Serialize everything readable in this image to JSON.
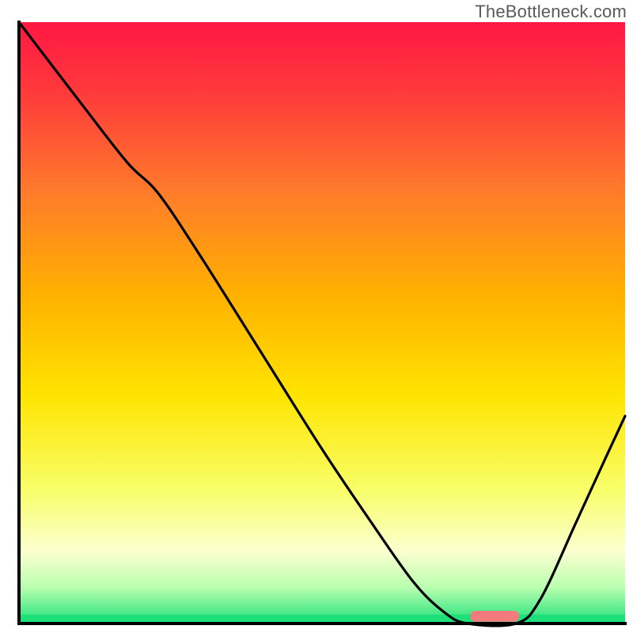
{
  "watermark": "TheBottleneck.com",
  "chart_data": {
    "type": "line",
    "title": "",
    "xlabel": "",
    "ylabel": "",
    "xlim": [
      0,
      100
    ],
    "ylim": [
      0,
      100
    ],
    "background_gradient": {
      "stops": [
        {
          "offset": 0.0,
          "color": "#ff1744"
        },
        {
          "offset": 0.12,
          "color": "#ff3b3b"
        },
        {
          "offset": 0.28,
          "color": "#ff7a2b"
        },
        {
          "offset": 0.45,
          "color": "#ffb000"
        },
        {
          "offset": 0.62,
          "color": "#ffe400"
        },
        {
          "offset": 0.78,
          "color": "#f8ff6a"
        },
        {
          "offset": 0.88,
          "color": "#fcffd0"
        },
        {
          "offset": 0.94,
          "color": "#b9ffb0"
        },
        {
          "offset": 1.0,
          "color": "#1ee07a"
        }
      ]
    },
    "curve": {
      "comment": "x as fraction of plot width (0=left,1=right), y as fraction (0=top,1=bottom). Approximated from pixels.",
      "points": [
        {
          "x": 0.0,
          "y": 0.0
        },
        {
          "x": 0.11,
          "y": 0.145
        },
        {
          "x": 0.18,
          "y": 0.235
        },
        {
          "x": 0.23,
          "y": 0.285
        },
        {
          "x": 0.3,
          "y": 0.39
        },
        {
          "x": 0.4,
          "y": 0.55
        },
        {
          "x": 0.5,
          "y": 0.71
        },
        {
          "x": 0.58,
          "y": 0.83
        },
        {
          "x": 0.65,
          "y": 0.93
        },
        {
          "x": 0.7,
          "y": 0.98
        },
        {
          "x": 0.74,
          "y": 1.0
        },
        {
          "x": 0.82,
          "y": 1.0
        },
        {
          "x": 0.86,
          "y": 0.96
        },
        {
          "x": 0.92,
          "y": 0.83
        },
        {
          "x": 0.97,
          "y": 0.72
        },
        {
          "x": 1.0,
          "y": 0.655
        }
      ]
    },
    "marker_bar": {
      "x_start": 0.745,
      "x_end": 0.825,
      "y": 0.988,
      "color": "#f37b7d",
      "thickness_frac": 0.018
    },
    "axes_color": "#000000"
  }
}
